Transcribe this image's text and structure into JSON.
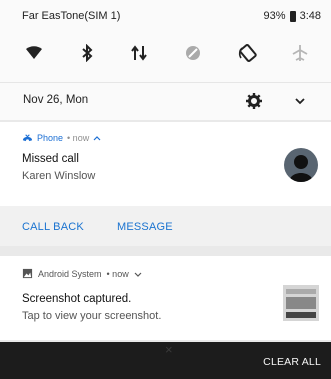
{
  "status_bar": {
    "carrier": "Far EasTone(SIM 1)",
    "battery": "93%",
    "time": "3:48"
  },
  "quick_settings": {
    "tiles": [
      {
        "icon": "wifi-icon",
        "state": "on"
      },
      {
        "icon": "bluetooth-icon",
        "state": "on"
      },
      {
        "icon": "mobile-data-icon",
        "state": "on"
      },
      {
        "icon": "do-not-disturb-icon",
        "state": "off"
      },
      {
        "icon": "auto-rotate-icon",
        "state": "on"
      },
      {
        "icon": "airplane-mode-icon",
        "state": "off"
      }
    ],
    "date": "Nov 26, Mon"
  },
  "notifications": {
    "missed_call": {
      "app": "Phone",
      "meta": "• now",
      "title": "Missed call",
      "text": "Karen Winslow",
      "actions": [
        "CALL BACK",
        "MESSAGE"
      ]
    },
    "screenshot": {
      "app": "Android System",
      "meta": "• now",
      "title": "Screenshot captured.",
      "text": "Tap to view your screenshot."
    }
  },
  "footer": {
    "clear_all": "CLEAR ALL"
  },
  "colors": {
    "accent": "#1a73d0",
    "shade_bg": "#fafafa",
    "footer_bg": "#1c1c1c"
  }
}
